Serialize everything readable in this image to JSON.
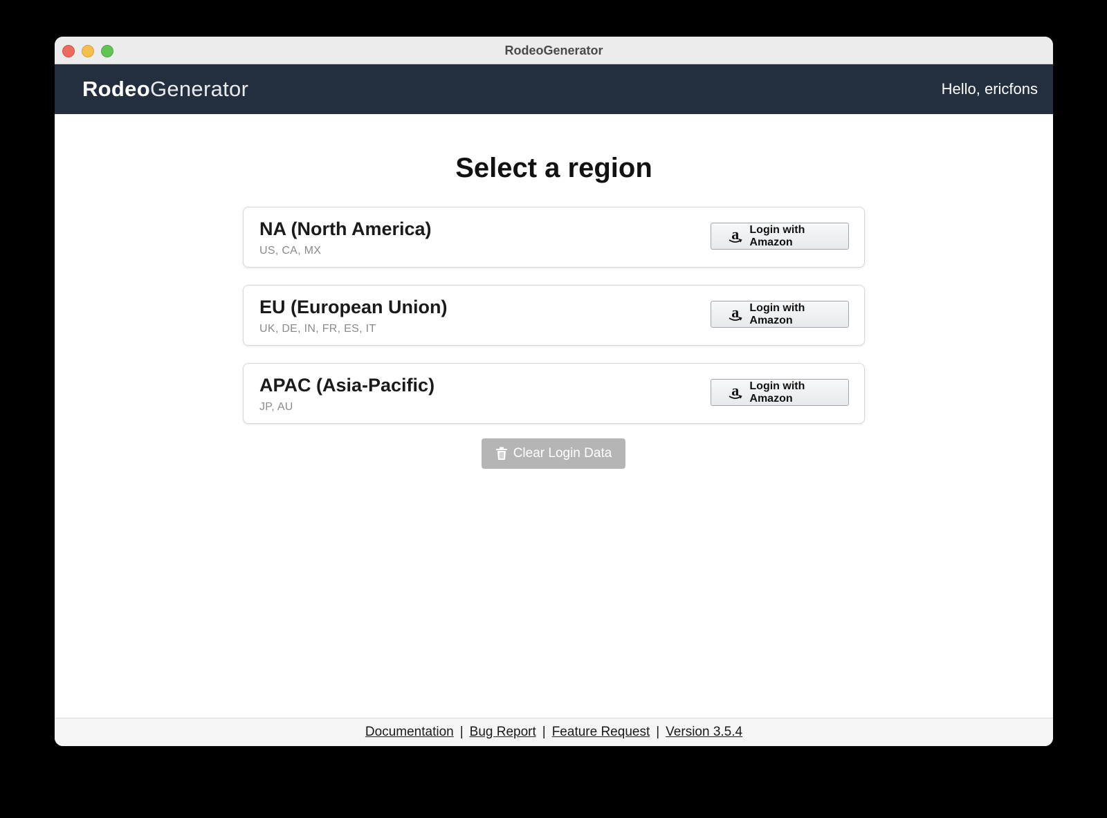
{
  "window": {
    "title": "RodeoGenerator"
  },
  "header": {
    "brand_bold": "Rodeo",
    "brand_light": "Generator",
    "greeting": "Hello, ericfons"
  },
  "main": {
    "title": "Select a region",
    "regions": [
      {
        "name": "NA (North America)",
        "countries": "US, CA, MX",
        "button_label": "Login with Amazon"
      },
      {
        "name": "EU (European Union)",
        "countries": "UK, DE, IN, FR, ES, IT",
        "button_label": "Login with Amazon"
      },
      {
        "name": "APAC (Asia-Pacific)",
        "countries": "JP, AU",
        "button_label": "Login with Amazon"
      }
    ],
    "clear_button_label": "Clear Login Data"
  },
  "footer": {
    "links": [
      "Documentation",
      "Bug Report",
      "Feature Request",
      "Version 3.5.4"
    ],
    "separator": "|"
  },
  "icons": {
    "amazon": "amazon-logo-icon",
    "trash": "trash-icon"
  },
  "colors": {
    "header_bg": "#232f3e",
    "clear_button_bg": "#b5b5b5",
    "amazon_orange": "#ff9900"
  }
}
